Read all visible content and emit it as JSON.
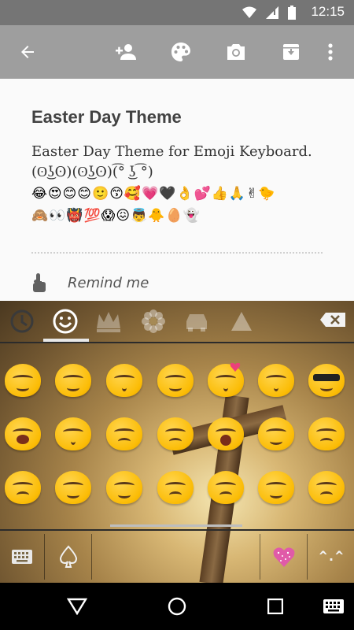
{
  "status_bar": {
    "time": "12:15"
  },
  "toolbar": {
    "icons": [
      "back-arrow-icon",
      "add-person-icon",
      "palette-icon",
      "camera-icon",
      "archive-icon",
      "more-vert-icon"
    ],
    "color": "#9e9e9e"
  },
  "post": {
    "title": "Easter Day Theme",
    "description": "Easter Day Theme for Emoji Keyboard.",
    "kaomoji": "(ʘ͜ʖʘ)(ʘ͜ʖʘ)(͡° ͜ʖ ͡°)",
    "emoji_line_1": "😂😍😊😊🙂😙🥰💗🖤👌💕👍🙏✌🐤",
    "emoji_line_2": "🙈👀👹💯😱😖👼🐥🥚👻",
    "remind_label": "Remind me"
  },
  "keyboard": {
    "categories": [
      "recent-clock-icon",
      "smiley-icon",
      "crown-icon",
      "flower-icon",
      "car-icon",
      "triangle-icon"
    ],
    "selected_category": "smiley-icon",
    "toggle_label": "^.^",
    "rows": [
      [
        "squint-laugh",
        "wink-tongue",
        "kissing",
        "grin-sweat",
        "kissing-heart",
        "kissing-blush",
        "sunglasses"
      ],
      [
        "crying-open-mouth",
        "kissing-face",
        "confounded",
        "disappointed",
        "screaming",
        "smirk",
        "sweat"
      ],
      [
        "persevering",
        "raised-hand",
        "hands-up",
        "pouting",
        "crossed-arms",
        "ok-gesture",
        "bowing"
      ]
    ]
  }
}
